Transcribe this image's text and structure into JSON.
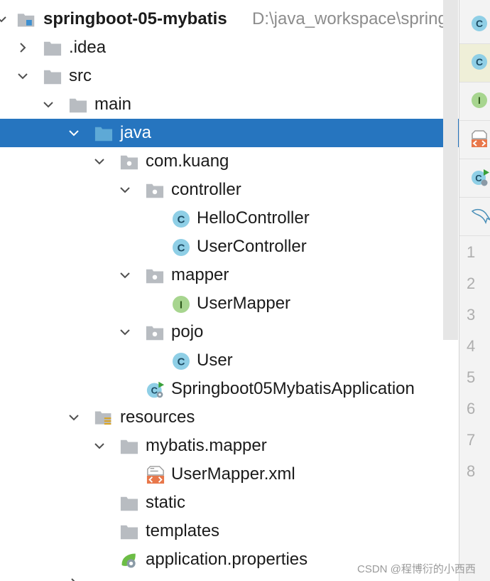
{
  "tree": {
    "root": {
      "name": "springboot-05-mybatis",
      "path": "D:\\java_workspace\\spring"
    },
    "items": [
      {
        "label": ".idea"
      },
      {
        "label": "src"
      },
      {
        "label": "main"
      },
      {
        "label": "java"
      },
      {
        "label": "com.kuang"
      },
      {
        "label": "controller"
      },
      {
        "label": "HelloController"
      },
      {
        "label": "UserController"
      },
      {
        "label": "mapper"
      },
      {
        "label": "UserMapper"
      },
      {
        "label": "pojo"
      },
      {
        "label": "User"
      },
      {
        "label": "Springboot05MybatisApplication"
      },
      {
        "label": "resources"
      },
      {
        "label": "mybatis.mapper"
      },
      {
        "label": "UserMapper.xml"
      },
      {
        "label": "static"
      },
      {
        "label": "templates"
      },
      {
        "label": "application.properties"
      }
    ]
  },
  "editor": {
    "tab_icons": [
      "class-icon",
      "class-icon",
      "interface-icon",
      "xml-file-icon",
      "spring-boot-class-icon",
      "mysql-dolphin-icon"
    ],
    "line_numbers": [
      "1",
      "2",
      "3",
      "4",
      "5",
      "6",
      "7",
      "8"
    ]
  },
  "watermark": "CSDN @程博衍的小西西",
  "colors": {
    "selection": "#2675bf",
    "folder": "#b8bcc1",
    "source_folder": "#5ea9d6",
    "class": "#8fcfe6",
    "interface": "#a7d58f",
    "xml": "#e8774a",
    "spring": "#6cbd45"
  }
}
